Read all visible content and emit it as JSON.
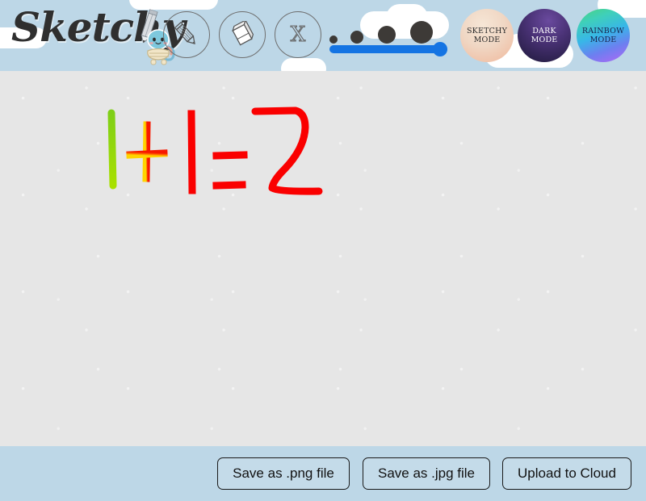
{
  "app": {
    "title": "Sketchy",
    "logo_icon": "pencil-icon",
    "mascot_icon": "turtle-mascot-icon",
    "sky_color": "#bdd7e7",
    "canvas_color": "#e6e6e6"
  },
  "toolbar": {
    "tools": [
      {
        "name": "pencil",
        "label": "Pencil tool",
        "icon": "pencil-icon",
        "selected": true
      },
      {
        "name": "eraser",
        "label": "Eraser tool",
        "icon": "eraser-icon",
        "selected": false
      },
      {
        "name": "clear",
        "label": "Clear canvas",
        "icon": "x-icon",
        "selected": false
      }
    ],
    "brush_size": {
      "name": "brush-size-slider",
      "value": 100,
      "min": 0,
      "max": 100,
      "track_color": "#1474e3",
      "preview_dots": [
        5,
        9,
        13,
        17
      ],
      "dot_color": "#3d3a37"
    },
    "modes": [
      {
        "name": "sketchy-mode",
        "line1": "SKETCHY",
        "line2": "MODE",
        "accent": "#f0b79a"
      },
      {
        "name": "dark-mode",
        "line1": "DARK",
        "line2": "MODE",
        "accent": "#1d1838"
      },
      {
        "name": "rainbow-mode",
        "line1": "RAINBOW",
        "line2": "MODE",
        "accent": "#38b6e8"
      }
    ]
  },
  "canvas": {
    "name": "drawing-canvas",
    "drawing_description": "1 + 1 = 2",
    "strokes": [
      {
        "glyph": "1",
        "color": "#8ed000"
      },
      {
        "glyph": "+",
        "color": "#ff5a00"
      },
      {
        "glyph": "1",
        "color": "#fa0000"
      },
      {
        "glyph": "=",
        "color": "#fa0000"
      },
      {
        "glyph": "2",
        "color": "#fa0000"
      }
    ]
  },
  "footer": {
    "buttons": [
      {
        "name": "save-png-button",
        "label": "Save as .png file"
      },
      {
        "name": "save-jpg-button",
        "label": "Save as .jpg file"
      },
      {
        "name": "upload-cloud-button",
        "label": "Upload to Cloud"
      }
    ]
  }
}
